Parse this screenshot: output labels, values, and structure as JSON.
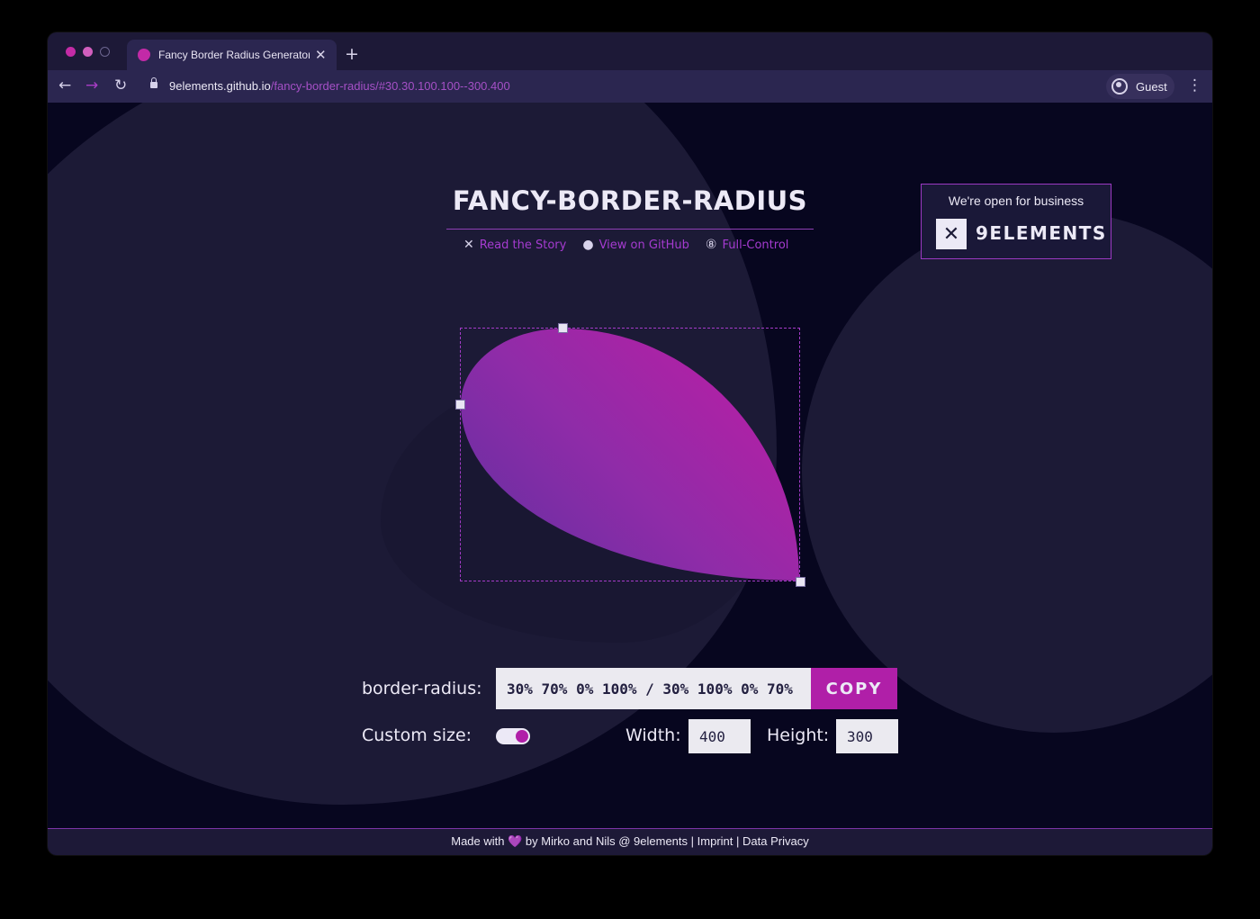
{
  "browser": {
    "tab_title": "Fancy Border Radius Generator",
    "tab_close": "✕",
    "new_tab": "+",
    "url_host": "9elements.github.io",
    "url_path": "/fancy-border-radius/#30.30.100.100--300.400",
    "profile_label": "Guest",
    "menu_icon": "⋮"
  },
  "header": {
    "title": "FANCY-BORDER-RADIUS",
    "links": [
      {
        "label": "Read the Story",
        "icon": "9elements-icon"
      },
      {
        "label": "View on GitHub",
        "icon": "github-icon"
      },
      {
        "label": "Full-Control",
        "icon": "8-icon"
      }
    ]
  },
  "business_badge": {
    "text": "We're open for business",
    "brand": "9ELEMENTS"
  },
  "controls": {
    "radius_label": "border-radius:",
    "radius_value": "30% 70% 0% 100% / 30% 100% 0% 70%",
    "copy_label": "COPY",
    "custom_size_label": "Custom size:",
    "custom_size_on": true,
    "width_label": "Width:",
    "width_value": "400",
    "height_label": "Height:",
    "height_value": "300"
  },
  "footer": {
    "made_with": "Made with",
    "heart": "💜",
    "by": "by Mirko and Nils @ 9elements",
    "imprint": "Imprint",
    "privacy": "Data Privacy",
    "sep": "|"
  },
  "colors": {
    "accent": "#b01fa8",
    "background": "#07061f",
    "blob": "#1c1a36"
  }
}
